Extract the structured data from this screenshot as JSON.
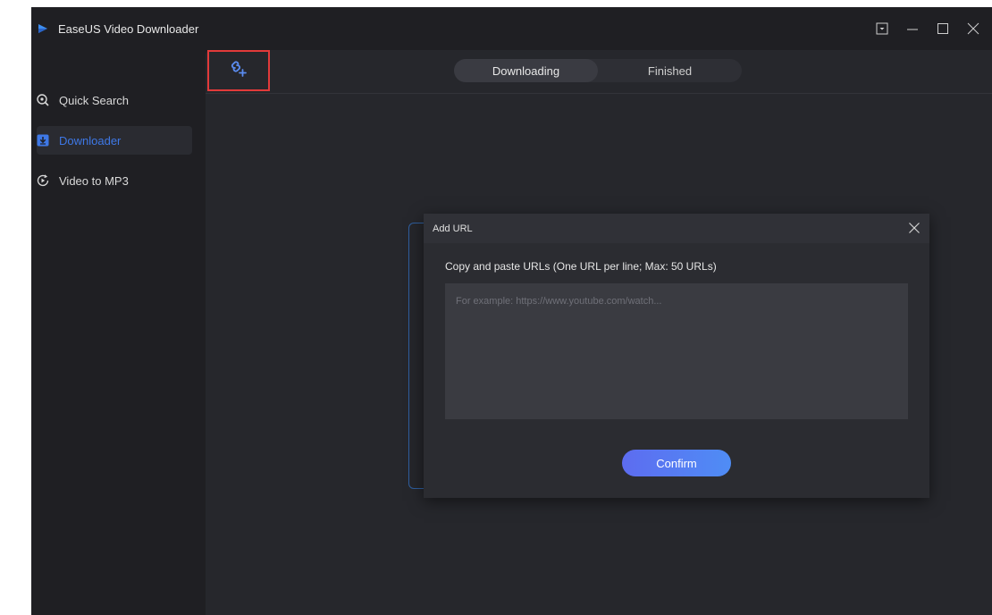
{
  "window": {
    "title": "EaseUS Video Downloader",
    "accent_color": "#3e78e6"
  },
  "sidebar": {
    "items": [
      {
        "label": "Quick Search",
        "icon": "search-icon",
        "active": false
      },
      {
        "label": "Downloader",
        "icon": "download-icon",
        "active": true
      },
      {
        "label": "Video to MP3",
        "icon": "convert-icon",
        "active": false
      }
    ]
  },
  "toolbar": {
    "add_url_icon": "add-link-icon",
    "tabs": [
      {
        "label": "Downloading",
        "active": true
      },
      {
        "label": "Finished",
        "active": false
      }
    ]
  },
  "modal": {
    "title": "Add URL",
    "instruction": "Copy and paste URLs (One URL per line; Max: 50 URLs)",
    "input_value": "",
    "input_placeholder": "For example: https://www.youtube.com/watch...",
    "confirm_label": "Confirm"
  },
  "colors": {
    "highlight_box": "#e23a3a",
    "confirm_gradient_start": "#5d6cf0",
    "confirm_gradient_end": "#4f8df5"
  }
}
